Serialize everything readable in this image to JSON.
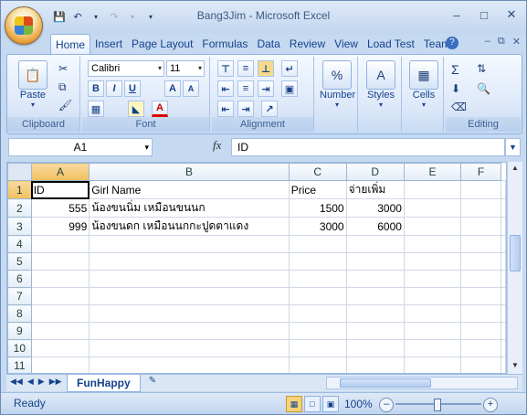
{
  "window": {
    "title": "Bang3Jim - Microsoft Excel"
  },
  "qat": {
    "save_icon": "save-icon",
    "undo_icon": "undo-icon",
    "redo_icon": "redo-icon"
  },
  "tabs": [
    "Home",
    "Insert",
    "Page Layout",
    "Formulas",
    "Data",
    "Review",
    "View",
    "Load Test",
    "Team"
  ],
  "ribbon": {
    "clipboard": {
      "label": "Clipboard",
      "paste_label": "Paste"
    },
    "font": {
      "label": "Font",
      "font_name": "Calibri",
      "font_size": "11",
      "bold": "B",
      "italic": "I",
      "underline": "U",
      "grow": "A",
      "shrink": "A",
      "font_color": "A"
    },
    "alignment": {
      "label": "Alignment"
    },
    "number": {
      "label": "Number",
      "symbol": "%"
    },
    "styles": {
      "label": "Styles"
    },
    "cells": {
      "label": "Cells"
    },
    "editing": {
      "label": "Editing"
    }
  },
  "formula_bar": {
    "name_box": "A1",
    "fx": "fx",
    "formula": "ID"
  },
  "sheet": {
    "columns": [
      "A",
      "B",
      "C",
      "D",
      "E",
      "F"
    ],
    "rows": [
      {
        "num": "1",
        "cells": [
          "ID",
          "Girl Name",
          "Price",
          "จ่ายเพิ่ม",
          "",
          ""
        ]
      },
      {
        "num": "2",
        "cells": [
          "555",
          "น้องขนนิ่ม   เหมือนขนนก",
          "1500",
          "3000",
          "",
          ""
        ]
      },
      {
        "num": "3",
        "cells": [
          "999",
          "น้องขนดก   เหมือนนกกะปูดตาแดง",
          "3000",
          "6000",
          "",
          ""
        ]
      },
      {
        "num": "4",
        "cells": [
          "",
          "",
          "",
          "",
          "",
          ""
        ]
      },
      {
        "num": "5",
        "cells": [
          "",
          "",
          "",
          "",
          "",
          ""
        ]
      },
      {
        "num": "6",
        "cells": [
          "",
          "",
          "",
          "",
          "",
          ""
        ]
      },
      {
        "num": "7",
        "cells": [
          "",
          "",
          "",
          "",
          "",
          ""
        ]
      },
      {
        "num": "8",
        "cells": [
          "",
          "",
          "",
          "",
          "",
          ""
        ]
      },
      {
        "num": "9",
        "cells": [
          "",
          "",
          "",
          "",
          "",
          ""
        ]
      },
      {
        "num": "10",
        "cells": [
          "",
          "",
          "",
          "",
          "",
          ""
        ]
      },
      {
        "num": "11",
        "cells": [
          "",
          "",
          "",
          "",
          "",
          ""
        ]
      }
    ],
    "sheet_tab": "FunHappy"
  },
  "status": {
    "ready": "Ready",
    "zoom": "100%"
  }
}
